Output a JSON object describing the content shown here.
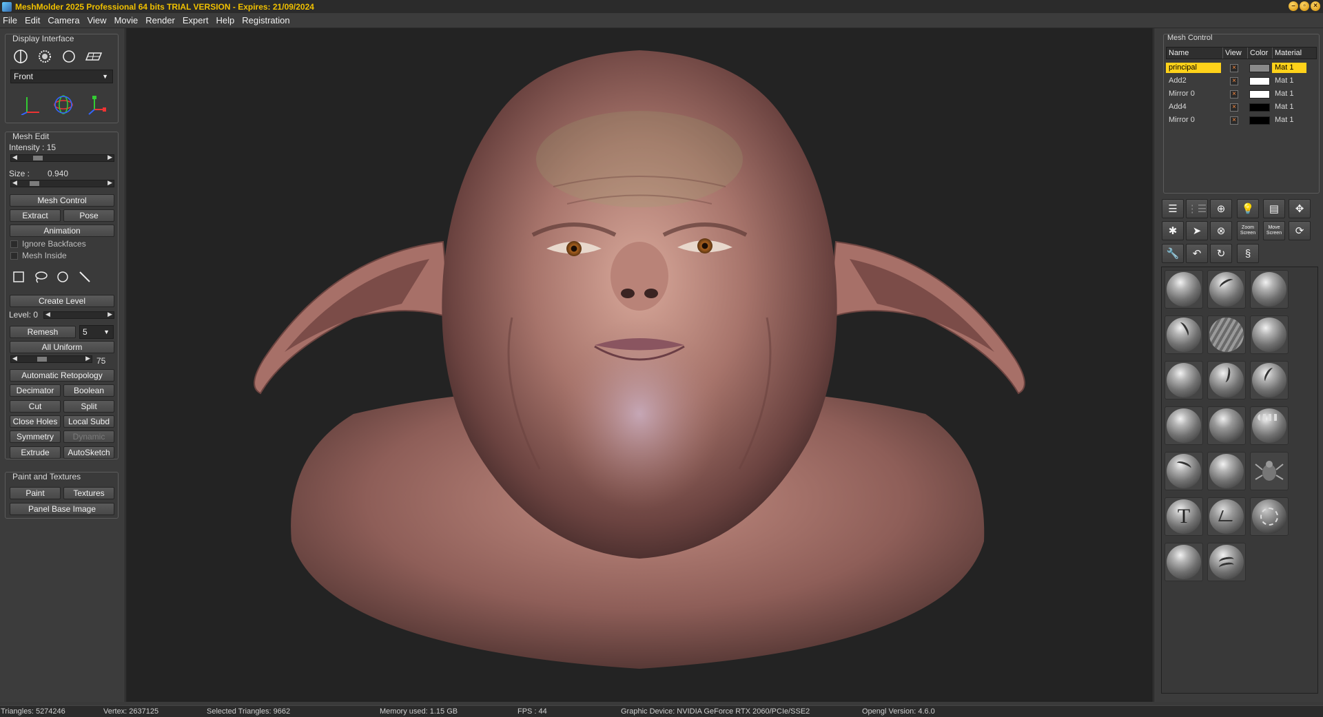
{
  "window": {
    "title": "MeshMolder 2025 Professional 64 bits TRIAL VERSION - Expires: 21/09/2024"
  },
  "menu": [
    "File",
    "Edit",
    "Camera",
    "View",
    "Movie",
    "Render",
    "Expert",
    "Help",
    "Registration"
  ],
  "display_interface": {
    "title": "Display Interface",
    "view_select": "Front"
  },
  "mesh_edit": {
    "title": "Mesh Edit",
    "intensity_label": "Intensity : 15",
    "intensity_value": 0.2,
    "size_label": "Size :",
    "size_value": "0.940",
    "size_slider": 0.15,
    "mesh_control": "Mesh Control",
    "extract": "Extract",
    "pose": "Pose",
    "animation": "Animation",
    "ignore_backfaces": "Ignore Backfaces",
    "mesh_inside": "Mesh Inside",
    "create_level": "Create Level",
    "level_label": "Level: 0",
    "remesh": "Remesh",
    "remesh_value": "5",
    "all_uniform": "All Uniform",
    "uniform_value": "75",
    "automatic_retopology": "Automatic Retopology",
    "decimator": "Decimator",
    "boolean": "Boolean",
    "cut": "Cut",
    "split": "Split",
    "close_holes": "Close Holes",
    "local_subd": "Local Subd",
    "symmetry": "Symmetry",
    "dynamic": "Dynamic",
    "extrude": "Extrude",
    "autosketch": "AutoSketch"
  },
  "paint_textures": {
    "title": "Paint and Textures",
    "paint": "Paint",
    "textures": "Textures",
    "panel_base_image": "Panel Base Image"
  },
  "mesh_control": {
    "title": "Mesh Control",
    "headers": [
      "Name",
      "View",
      "Color",
      "Material"
    ],
    "rows": [
      {
        "name": "principal",
        "view": "×",
        "color": "#8a8a8a",
        "material": "Mat 1",
        "selected": true
      },
      {
        "name": "Add2",
        "view": "×",
        "color": "#ffffff",
        "material": "Mat 1",
        "selected": false
      },
      {
        "name": "Mirror 0",
        "view": "×",
        "color": "#ffffff",
        "material": "Mat 1",
        "selected": false
      },
      {
        "name": "Add4",
        "view": "×",
        "color": "#000000",
        "material": "Mat 1",
        "selected": false
      },
      {
        "name": "Mirror 0",
        "view": "×",
        "color": "#000000",
        "material": "Mat 1",
        "selected": false
      }
    ]
  },
  "tools": {
    "zoom_screen": "Zoom Screen",
    "move_screen": "Move Screen"
  },
  "brushes": {
    "text_brush": "T"
  },
  "status": {
    "triangles": "Triangles: 5274246",
    "vertex": "Vertex: 2637125",
    "selected": "Selected Triangles: 9662",
    "memory": "Memory used: 1.15 GB",
    "fps": "FPS : 44",
    "device": "Graphic Device: NVIDIA GeForce RTX 2060/PCIe/SSE2",
    "opengl": "Opengl Version: 4.6.0"
  },
  "colors": {
    "accent": "#ffd21a",
    "title": "#f0c000",
    "skin": "#b9877a"
  }
}
